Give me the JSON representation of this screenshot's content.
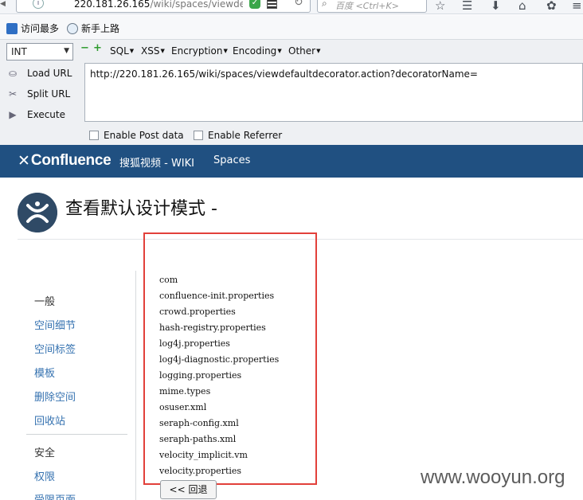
{
  "browser": {
    "url_host": "220.181.26.165",
    "url_path": "/wiki/spaces/viewdefau",
    "search_placeholder": "百度 <Ctrl+K>"
  },
  "bookmarks": [
    {
      "label": "访问最多",
      "icon": "bookmark-icon"
    },
    {
      "label": "新手上路",
      "icon": "globe-icon"
    }
  ],
  "hackbar": {
    "select_value": "INT",
    "menus": [
      "SQL",
      "XSS",
      "Encryption",
      "Encoding",
      "Other"
    ],
    "actions": [
      {
        "label": "Load URL",
        "icon": "load-url-icon"
      },
      {
        "label": "Split URL",
        "icon": "split-url-icon"
      },
      {
        "label": "Execute",
        "icon": "execute-icon"
      }
    ],
    "url_value": "http://220.181.26.165/wiki/spaces/viewdefaultdecorator.action?decoratorName=",
    "enable_post": "Enable Post data",
    "enable_referrer": "Enable Referrer"
  },
  "confluence": {
    "logo_text": "Confluence",
    "wiki_link": "搜狐视频 - WIKI",
    "spaces_link": "Spaces"
  },
  "page": {
    "title": "查看默认设计模式 -",
    "back_button": "<< 回退"
  },
  "sidebar": {
    "general_heading": "一般",
    "general_items": [
      "空间细节",
      "空间标签",
      "模板",
      "删除空间",
      "回收站"
    ],
    "security_heading": "安全",
    "security_items": [
      "权限",
      "受限页面"
    ]
  },
  "files": [
    "com",
    "confluence-init.properties",
    "crowd.properties",
    "hash-registry.properties",
    "log4j.properties",
    "log4j-diagnostic.properties",
    "logging.properties",
    "mime.types",
    "osuser.xml",
    "seraph-config.xml",
    "seraph-paths.xml",
    "velocity_implicit.vm",
    "velocity.properties"
  ],
  "watermark": "www.wooyun.org",
  "colors": {
    "header_bg": "#205081",
    "link": "#3572b0",
    "highlight_box": "#e2403a"
  }
}
